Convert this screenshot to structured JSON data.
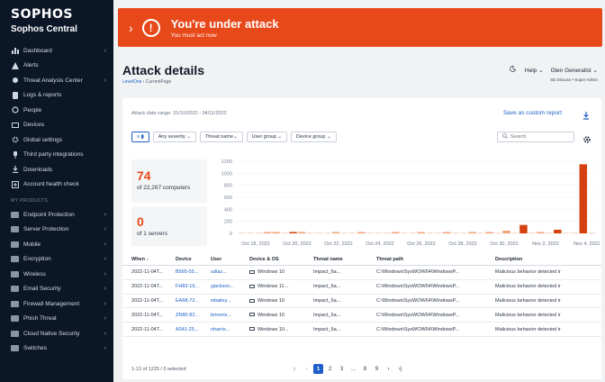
{
  "sidebar": {
    "brand": "SOPHOS",
    "product": "Sophos Central",
    "items": [
      {
        "label": "Dashboard",
        "icon": "bar-chart-icon",
        "chevron": true
      },
      {
        "label": "Alerts",
        "icon": "warning-icon",
        "chevron": false
      },
      {
        "label": "Threat Analysis Center",
        "icon": "threat-analysis-icon",
        "chevron": true
      },
      {
        "label": "Logs & reports",
        "icon": "logs-icon",
        "chevron": false
      },
      {
        "label": "People",
        "icon": "people-icon",
        "chevron": false
      },
      {
        "label": "Devices",
        "icon": "devices-icon",
        "chevron": false
      },
      {
        "label": "Global settings",
        "icon": "gear-icon",
        "chevron": false
      },
      {
        "label": "Third party integrations",
        "icon": "plug-icon",
        "chevron": false
      },
      {
        "label": "Downloads",
        "icon": "download-icon",
        "chevron": false
      },
      {
        "label": "Account health check",
        "icon": "health-check-icon",
        "chevron": false
      }
    ],
    "section_label": "MY PRODUCTS",
    "products": [
      {
        "label": "Endpoint Protection",
        "icon": "product-icon"
      },
      {
        "label": "Server Protection",
        "icon": "product-icon"
      },
      {
        "label": "Mobile",
        "icon": "product-icon"
      },
      {
        "label": "Encryption",
        "icon": "product-icon"
      },
      {
        "label": "Wireless",
        "icon": "product-icon"
      },
      {
        "label": "Email Security",
        "icon": "product-icon"
      },
      {
        "label": "Firewall Management",
        "icon": "product-icon"
      },
      {
        "label": "Phish Threat",
        "icon": "product-icon"
      },
      {
        "label": "Cloud Native Security",
        "icon": "product-icon"
      },
      {
        "label": "Switches",
        "icon": "product-icon"
      }
    ]
  },
  "banner": {
    "title": "You're under attack",
    "subtitle": "You must act now",
    "color": "#e8491b"
  },
  "header": {
    "title": "Attack details",
    "breadcrumb_root": "LevelOne",
    "breadcrumb_current": "CurrentPage",
    "help_label": "Help",
    "user_label": "Glen Generalist",
    "user_sub": "SE Discuss • Super Admin"
  },
  "card": {
    "date_range": "Attack date range: 31/10/2022 - 04/11/2022",
    "save_label": "Save as custom report",
    "filters": {
      "toggle_label": "≡ ▮",
      "severity": "Any severity",
      "threat_name": "Threat name",
      "user_group": "User group",
      "device_group": "Device group"
    },
    "search_placeholder": "Search",
    "stats": [
      {
        "number": "74",
        "label": "of 22,267 computers"
      },
      {
        "number": "0",
        "label": "of 1 servers"
      }
    ]
  },
  "chart_data": {
    "type": "bar",
    "ylim": [
      0,
      1200
    ],
    "yticks": [
      "1200",
      "1000",
      "800",
      "600",
      "400",
      "200",
      "0"
    ],
    "xticks": [
      "Oct 18, 2022",
      "Oct 20, 2022",
      "Oct 22, 2022",
      "Oct 24, 2022",
      "Oct 26, 2022",
      "Oct 28, 2022",
      "Oct 30, 2022",
      "Nov 2, 2022",
      "Nov 4, 2022"
    ],
    "colors": {
      "primary": "#d6410f",
      "secondary": "#f0a57c"
    },
    "bars": [
      {
        "x": 3,
        "value": 8,
        "color": "secondary"
      },
      {
        "x": 4,
        "value": 10,
        "color": "secondary"
      },
      {
        "x": 6,
        "value": 20,
        "color": "primary"
      },
      {
        "x": 7,
        "value": 15,
        "color": "secondary"
      },
      {
        "x": 11,
        "value": 8,
        "color": "secondary"
      },
      {
        "x": 14,
        "value": 6,
        "color": "secondary"
      },
      {
        "x": 18,
        "value": 10,
        "color": "secondary"
      },
      {
        "x": 21,
        "value": 8,
        "color": "secondary"
      },
      {
        "x": 24,
        "value": 12,
        "color": "secondary"
      },
      {
        "x": 27,
        "value": 10,
        "color": "secondary"
      },
      {
        "x": 29,
        "value": 8,
        "color": "secondary"
      },
      {
        "x": 31,
        "value": 45,
        "color": "secondary"
      },
      {
        "x": 33,
        "value": 140,
        "color": "primary"
      },
      {
        "x": 35,
        "value": 20,
        "color": "secondary"
      },
      {
        "x": 37,
        "value": 60,
        "color": "primary"
      },
      {
        "x": 40,
        "value": 1150,
        "color": "primary"
      }
    ],
    "x_count": 42
  },
  "table": {
    "columns": [
      "When ↓",
      "Device",
      "User",
      "Device & OS",
      "Threat name",
      "Threat path",
      "Description"
    ],
    "rows": [
      [
        "2022-11-04T...",
        "B565-55...",
        "udiaz...",
        "Windows 10",
        "Impact_6a...",
        "C:\\Windows\\SysWOW64\\WindowsP...",
        "Malicious behavior detected ir"
      ],
      [
        "2022-11-04T...",
        "FH83-19...",
        "yjackson...",
        "Windows 11...",
        "Impact_6a...",
        "C:\\Windows\\SysWOW64\\WindowsP...",
        "Malicious behavior detected ir"
      ],
      [
        "2022-11-04T...",
        "EA68-72...",
        "wbailey...",
        "Windows 10",
        "Impact_6a...",
        "C:\\Windows\\SysWOW64\\WindowsP...",
        "Malicious behavior detected ir"
      ],
      [
        "2022-11-04T...",
        "ZR80-82...",
        "bmorris...",
        "Windows 10",
        "Impact_6a...",
        "C:\\Windows\\SysWOW64\\WindowsP...",
        "Malicious behavior detected ir"
      ],
      [
        "2022-11-04T...",
        "A341-25...",
        "nharris...",
        "Windows 10...",
        "Impact_6a...",
        "C:\\Windows\\SysWOW64\\WindowsP...",
        "Malicious behavior detected ir"
      ]
    ]
  },
  "footer": {
    "page_info": "1-12 of 1225 / 0 selected",
    "pages": [
      "1",
      "2",
      "3",
      "...",
      "8",
      "9"
    ]
  }
}
